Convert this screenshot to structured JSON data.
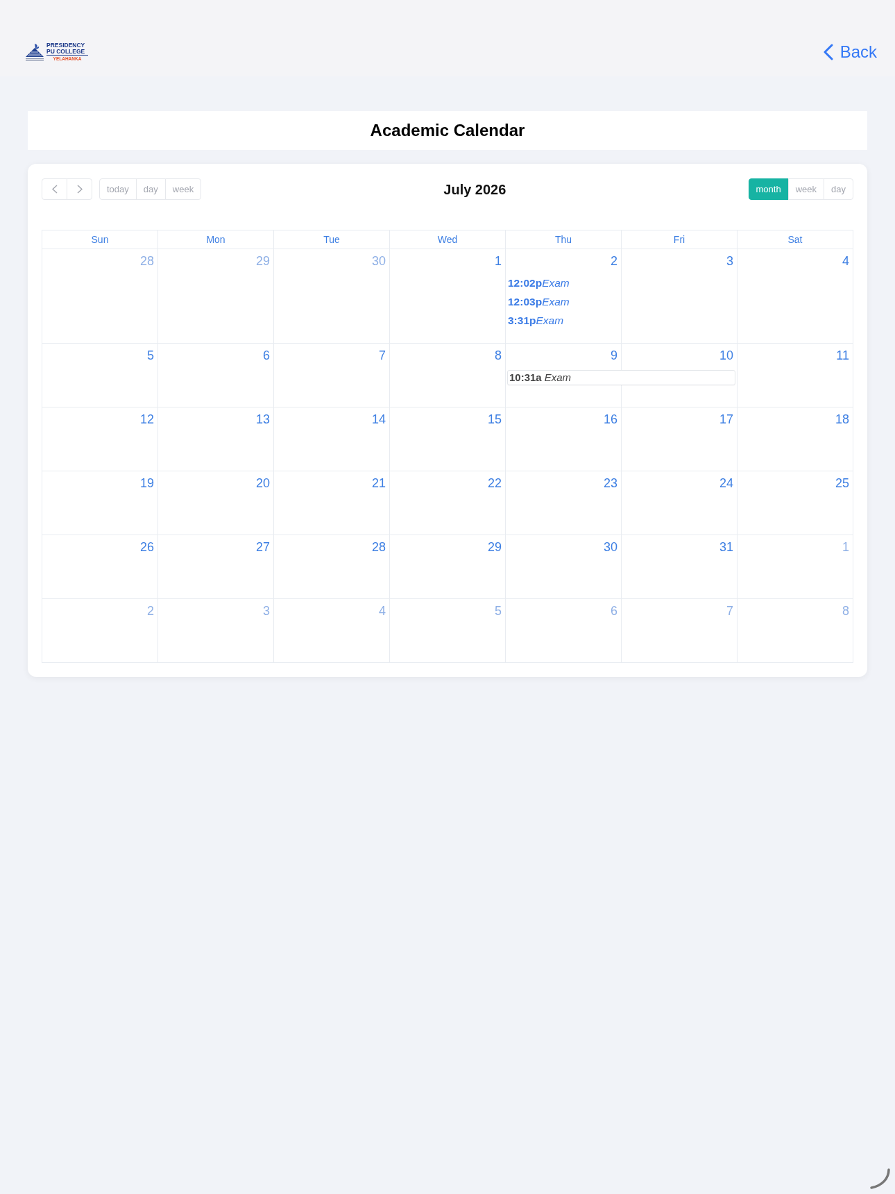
{
  "header": {
    "logo": {
      "name": "PRESIDENCY PU COLLEGE",
      "place": "YELAHANKA"
    },
    "back_label": "Back"
  },
  "page_title": "Academic Calendar",
  "calendar": {
    "title": "July 2026",
    "left_buttons": [
      "today",
      "day",
      "week"
    ],
    "views": [
      {
        "label": "month",
        "selected": true
      },
      {
        "label": "week",
        "selected": false
      },
      {
        "label": "day",
        "selected": false
      }
    ],
    "weekdays": [
      "Sun",
      "Mon",
      "Tue",
      "Wed",
      "Thu",
      "Fri",
      "Sat"
    ],
    "weeks": [
      {
        "days": [
          {
            "date": "28",
            "other_month": true
          },
          {
            "date": "29",
            "other_month": true
          },
          {
            "date": "30",
            "other_month": true
          },
          {
            "date": "1",
            "other_month": false
          },
          {
            "date": "2",
            "other_month": false,
            "events": [
              {
                "kind": "inline",
                "time": "12:02p",
                "title": "Exam"
              },
              {
                "kind": "inline",
                "time": "12:03p",
                "title": "Exam"
              },
              {
                "kind": "inline",
                "time": "3:31p",
                "title": "Exam"
              }
            ]
          },
          {
            "date": "3",
            "other_month": false
          },
          {
            "date": "4",
            "other_month": false
          }
        ]
      },
      {
        "days": [
          {
            "date": "5",
            "other_month": false
          },
          {
            "date": "6",
            "other_month": false
          },
          {
            "date": "7",
            "other_month": false
          },
          {
            "date": "8",
            "other_month": false
          },
          {
            "date": "9",
            "other_month": false,
            "events": [
              {
                "kind": "block",
                "time": "10:31a",
                "title": "Exam",
                "spans_next_day": true
              }
            ]
          },
          {
            "date": "10",
            "other_month": false
          },
          {
            "date": "11",
            "other_month": false
          }
        ]
      },
      {
        "days": [
          {
            "date": "12",
            "other_month": false
          },
          {
            "date": "13",
            "other_month": false
          },
          {
            "date": "14",
            "other_month": false
          },
          {
            "date": "15",
            "other_month": false
          },
          {
            "date": "16",
            "other_month": false
          },
          {
            "date": "17",
            "other_month": false
          },
          {
            "date": "18",
            "other_month": false
          }
        ]
      },
      {
        "days": [
          {
            "date": "19",
            "other_month": false
          },
          {
            "date": "20",
            "other_month": false
          },
          {
            "date": "21",
            "other_month": false
          },
          {
            "date": "22",
            "other_month": false
          },
          {
            "date": "23",
            "other_month": false
          },
          {
            "date": "24",
            "other_month": false
          },
          {
            "date": "25",
            "other_month": false
          }
        ]
      },
      {
        "days": [
          {
            "date": "26",
            "other_month": false
          },
          {
            "date": "27",
            "other_month": false
          },
          {
            "date": "28",
            "other_month": false
          },
          {
            "date": "29",
            "other_month": false
          },
          {
            "date": "30",
            "other_month": false
          },
          {
            "date": "31",
            "other_month": false
          },
          {
            "date": "1",
            "other_month": true
          }
        ]
      },
      {
        "days": [
          {
            "date": "2",
            "other_month": true
          },
          {
            "date": "3",
            "other_month": true
          },
          {
            "date": "4",
            "other_month": true
          },
          {
            "date": "5",
            "other_month": true
          },
          {
            "date": "6",
            "other_month": true
          },
          {
            "date": "7",
            "other_month": true
          },
          {
            "date": "8",
            "other_month": true
          }
        ]
      }
    ]
  }
}
